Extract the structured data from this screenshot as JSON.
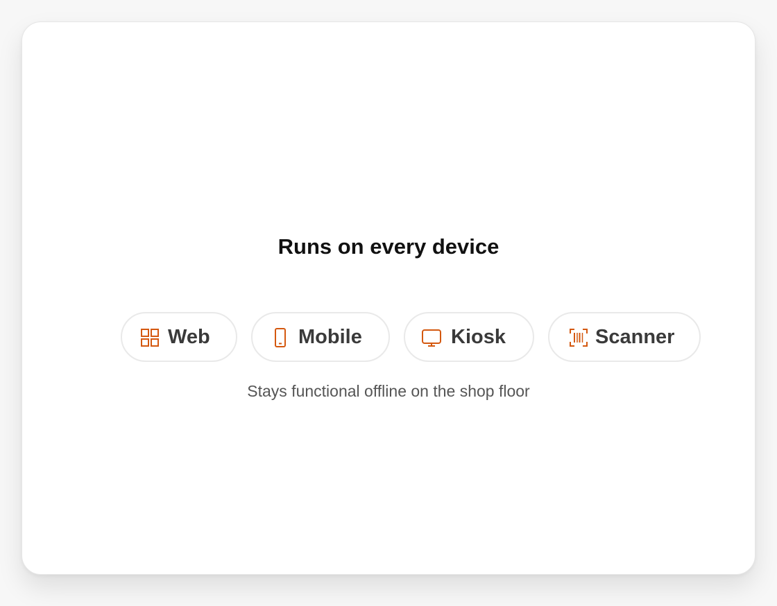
{
  "heading": "Runs on every device",
  "accent_color": "#d4580f",
  "devices": [
    {
      "label": "Web",
      "icon": "grid-icon"
    },
    {
      "label": "Mobile",
      "icon": "phone-icon"
    },
    {
      "label": "Kiosk",
      "icon": "monitor-icon"
    },
    {
      "label": "Scanner",
      "icon": "barcode-scanner-icon"
    }
  ],
  "subtitle": "Stays functional offline on the shop floor"
}
